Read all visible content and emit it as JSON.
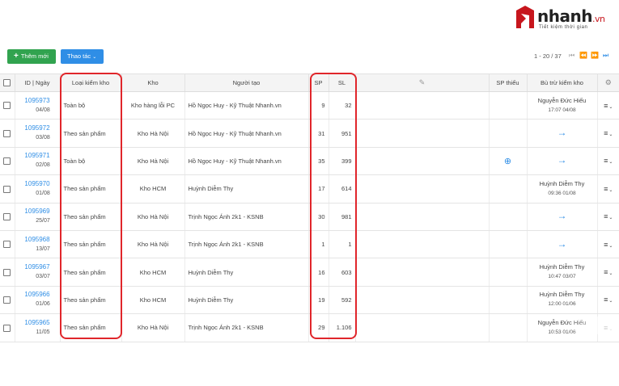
{
  "brand": {
    "name": "nhanh",
    "suffix": ".vn",
    "slogan": "Tiết kiệm thời gian",
    "color": "#c7161d"
  },
  "toolbar": {
    "add_label": "Thêm mới",
    "actions_label": "Thao tác",
    "pager_text": "1 - 20 / 37"
  },
  "table": {
    "headers": {
      "id": "ID | Ngày",
      "type": "Loại kiểm kho",
      "warehouse": "Kho",
      "creator": "Người tạo",
      "sp": "SP",
      "sl": "SL",
      "sp_missing": "SP thiếu",
      "offset": "Bù trừ kiểm kho"
    },
    "rows": [
      {
        "id": "1095973",
        "date": "04/08",
        "type": "Toàn bộ",
        "warehouse": "Kho hàng lỗi PC",
        "creator": "Hồ Ngọc Huy - Kỹ Thuật Nhanh.vn",
        "sp": "9",
        "sl": "32",
        "offset_name": "Nguyễn Đức Hiếu",
        "offset_time": "17:07 04/08"
      },
      {
        "id": "1095972",
        "date": "03/08",
        "type": "Theo sản phẩm",
        "warehouse": "Kho Hà Nội",
        "creator": "Hồ Ngọc Huy - Kỹ Thuật Nhanh.vn",
        "sp": "31",
        "sl": "951",
        "offset_name": "",
        "offset_time": ""
      },
      {
        "id": "1095971",
        "date": "02/08",
        "type": "Toàn bộ",
        "warehouse": "Kho Hà Nội",
        "creator": "Hồ Ngọc Huy - Kỹ Thuật Nhanh.vn",
        "sp": "35",
        "sl": "399",
        "offset_name": "",
        "offset_time": ""
      },
      {
        "id": "1095970",
        "date": "01/08",
        "type": "Theo sản phẩm",
        "warehouse": "Kho HCM",
        "creator": "Huỳnh Diễm Thy",
        "sp": "17",
        "sl": "614",
        "offset_name": "Huỳnh Diễm Thy",
        "offset_time": "09:36 01/08"
      },
      {
        "id": "1095969",
        "date": "25/07",
        "type": "Theo sản phẩm",
        "warehouse": "Kho Hà Nội",
        "creator": "Trịnh Ngọc Ánh 2k1 - KSNB",
        "sp": "30",
        "sl": "981",
        "offset_name": "",
        "offset_time": ""
      },
      {
        "id": "1095968",
        "date": "13/07",
        "type": "Theo sản phẩm",
        "warehouse": "Kho Hà Nội",
        "creator": "Trịnh Ngọc Ánh 2k1 - KSNB",
        "sp": "1",
        "sl": "1",
        "offset_name": "",
        "offset_time": ""
      },
      {
        "id": "1095967",
        "date": "03/07",
        "type": "Theo sản phẩm",
        "warehouse": "Kho HCM",
        "creator": "Huỳnh Diễm Thy",
        "sp": "16",
        "sl": "603",
        "offset_name": "Huỳnh Diễm Thy",
        "offset_time": "10:47 03/07"
      },
      {
        "id": "1095966",
        "date": "01/06",
        "type": "Theo sản phẩm",
        "warehouse": "Kho HCM",
        "creator": "Huỳnh Diễm Thy",
        "sp": "19",
        "sl": "592",
        "offset_name": "Huỳnh Diễm Thy",
        "offset_time": "12:00 01/06"
      },
      {
        "id": "1095965",
        "date": "11/05",
        "type": "Theo sản phẩm",
        "warehouse": "Kho Hà Nội",
        "creator": "Trịnh Ngọc Ánh 2k1 - KSNB",
        "sp": "29",
        "sl": "1.106",
        "offset_name": "Nguyễn Đức Hiếu",
        "offset_time": "10:53 01/06"
      }
    ]
  },
  "colors": {
    "primary": "#2f8ee6",
    "add": "#31a34f",
    "highlight": "#e0262b"
  }
}
